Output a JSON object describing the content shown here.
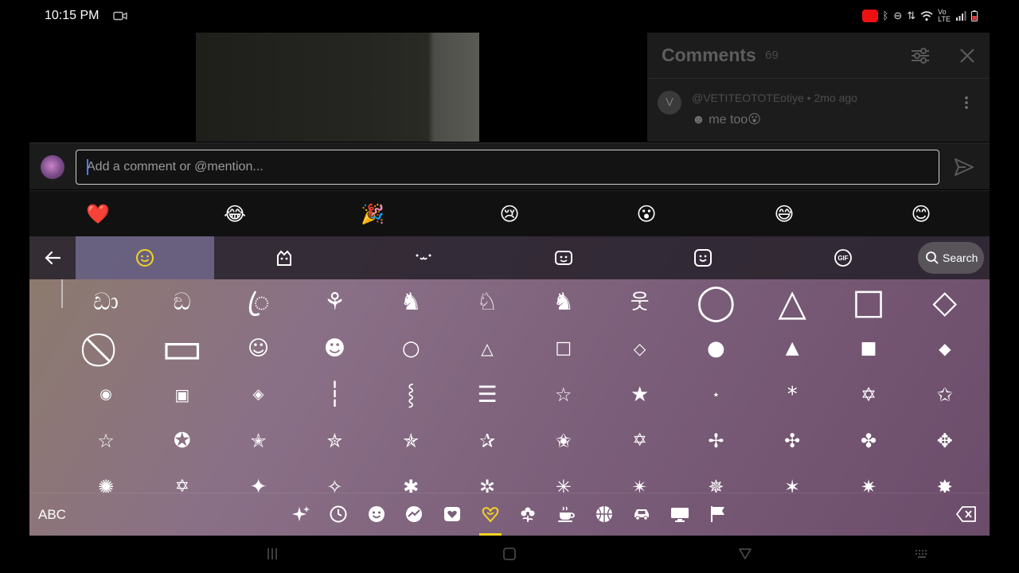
{
  "status_bar": {
    "time": "10:15 PM",
    "network_label_top": "Vo",
    "network_label_bottom": "LTE",
    "icons": [
      "video-camera-icon",
      "recording-icon",
      "bluetooth-icon",
      "do-not-disturb-icon",
      "data-arrows-icon",
      "wifi-icon",
      "volte-icon",
      "signal-icon",
      "battery-icon"
    ]
  },
  "comments": {
    "title": "Comments",
    "count": "69",
    "items": [
      {
        "avatar_letter": "V",
        "meta": "@VETITEOTOTEotiye • 2mo ago",
        "text": "☻ me too😮"
      }
    ]
  },
  "comment_input": {
    "placeholder": "Add a comment or @mention...",
    "value": ""
  },
  "reactions": [
    "❤️",
    "😂",
    "🎉",
    "😢",
    "😮",
    "😅",
    "😊"
  ],
  "keyboard": {
    "tabs": [
      "emoji-tab",
      "stickers-tab",
      "kaomoji-tab",
      "bitmoji-tab",
      "sticker-smile-tab",
      "gif-tab"
    ],
    "search_label": "Search",
    "abc_label": "ABC",
    "active_category": "symbols",
    "symbols": [
      [
        "ඩා",
        "ඞ",
        "ꦿ",
        "⚘",
        "♞",
        "♘",
        "♞",
        "웃",
        "◯",
        "△",
        "□",
        "◇"
      ],
      [
        "⃠",
        "▭",
        "☺",
        "☻",
        "○",
        "△",
        "□",
        "◇",
        "●",
        "▲",
        "■",
        "◆"
      ],
      [
        "◉",
        "▣",
        "◈",
        "┆",
        "⸾",
        "☰",
        "☆",
        "★",
        "⋆",
        "*",
        "✡",
        "✩"
      ],
      [
        "☆",
        "✪",
        "✭",
        "✮",
        "✯",
        "✰",
        "✬",
        "✡",
        "✢",
        "✣",
        "✤",
        "✥"
      ],
      [
        "✺",
        "✡",
        "✦",
        "✧",
        "✱",
        "✲",
        "✳",
        "✴",
        "✵",
        "✶",
        "✷",
        "✸"
      ]
    ],
    "categories": [
      "sparkle-icon",
      "recent-clock-icon",
      "smiley-icon",
      "activity-icon",
      "heart-box-icon",
      "symbols-icon",
      "flower-icon",
      "coffee-icon",
      "basketball-icon",
      "car-icon",
      "computer-icon",
      "flag-icon"
    ]
  },
  "colors": {
    "accent_yellow": "#f2d325",
    "caret_blue": "#4a7cff",
    "record_red": "#e11111"
  }
}
